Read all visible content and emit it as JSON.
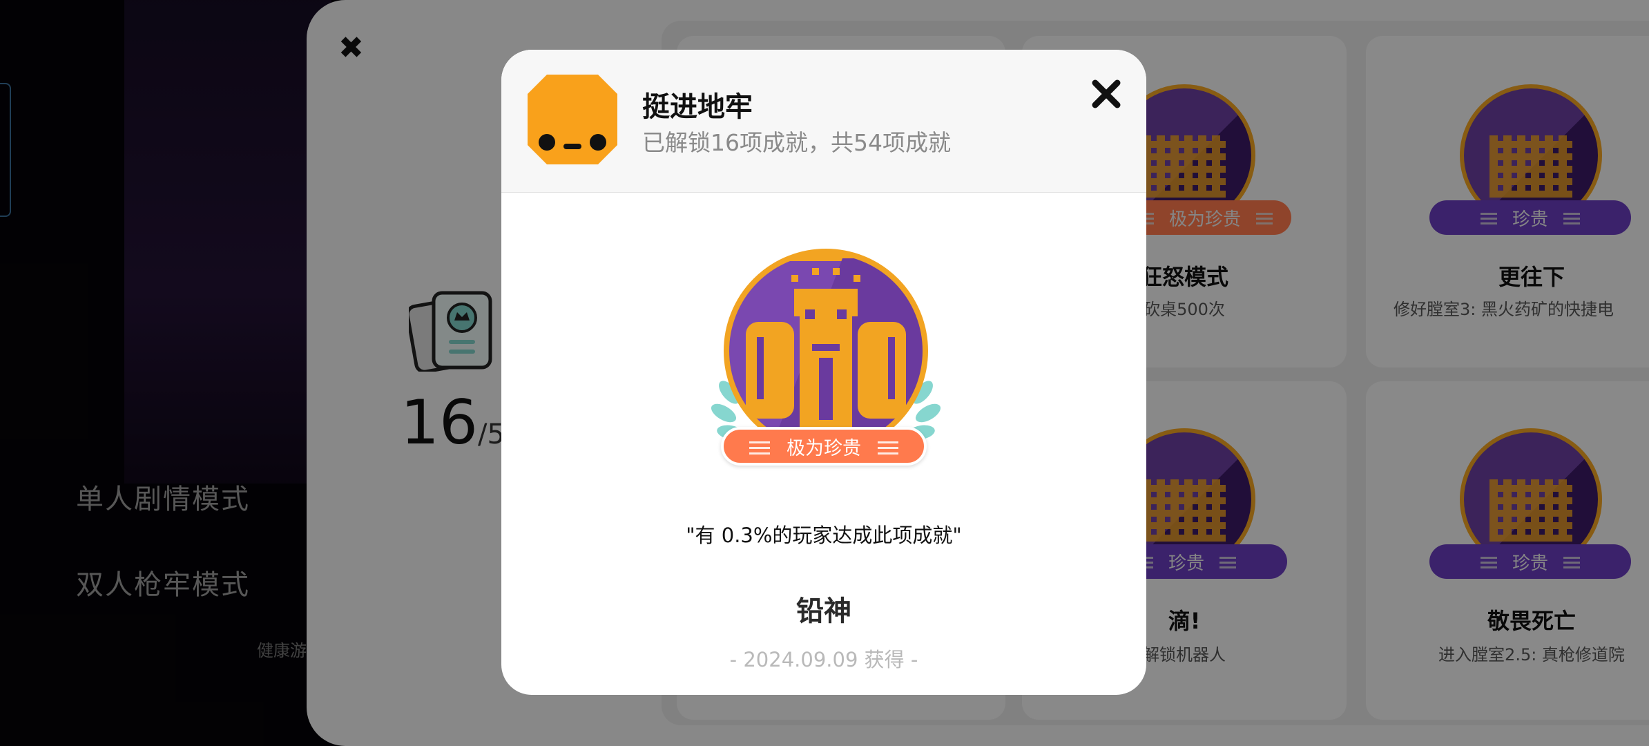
{
  "background_menu": {
    "items": [
      "单人剧情模式",
      "双人枪牢模式"
    ],
    "health_tip": "健康游"
  },
  "panel": {
    "close_glyph": "✖",
    "unlocked_count": "16",
    "total_partial": "/5",
    "cards": [
      {
        "title": "狂怒模式",
        "desc": "砍桌500次",
        "rarity": "极为珍贵",
        "rarity_color": "#ff7a4d"
      },
      {
        "title": "更往下",
        "desc": "修好膛室3: 黑火药矿的快捷电",
        "rarity": "珍贵",
        "rarity_color": "#6a3dbf"
      },
      {
        "title": "滴!",
        "desc": "解锁机器人",
        "rarity": "珍贵",
        "rarity_color": "#6a3dbf"
      },
      {
        "title": "敬畏死亡",
        "desc": "进入膛室2.5: 真枪修道院",
        "rarity": "珍贵",
        "rarity_color": "#6a3dbf"
      }
    ]
  },
  "modal": {
    "game_title": "挺进地牢",
    "game_subtitle": "已解锁16项成就，共54项成就",
    "rarity": "极为珍贵",
    "quote": "\"有 0.3%的玩家达成此项成就\"",
    "achievement_name": "铅神",
    "obtained": "- 2024.09.09 获得 -",
    "colors": {
      "accent_orange": "#ff7a4d",
      "badge_purple": "#6b3fa0",
      "gold": "#f2a422",
      "icon_yellow": "#f9a11b"
    }
  }
}
